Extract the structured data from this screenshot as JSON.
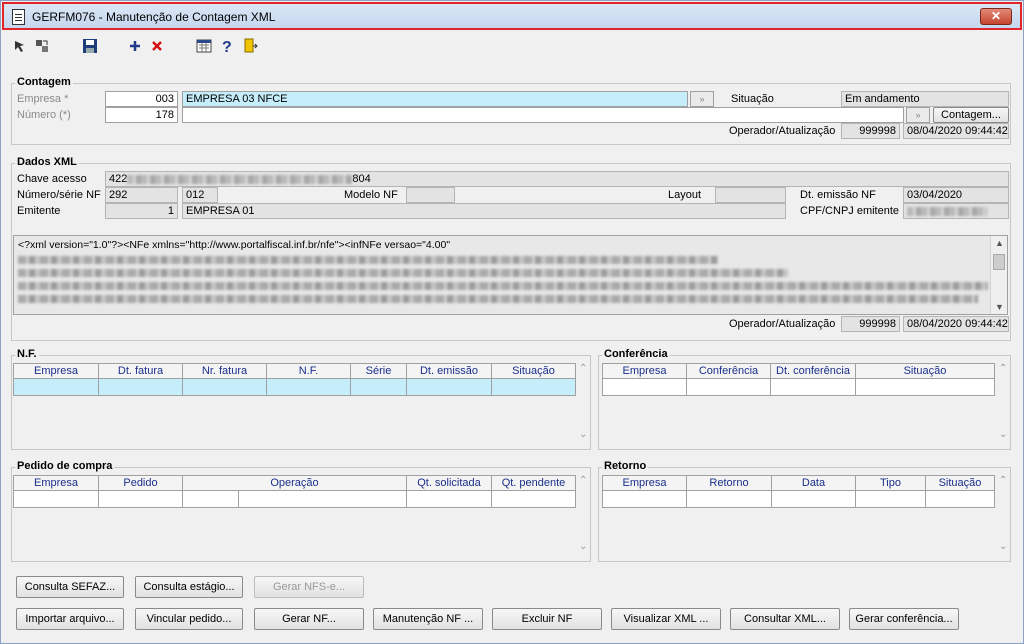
{
  "window": {
    "title": "GERFM076 - Manutenção de Contagem XML",
    "close_label": "✕"
  },
  "toolbar": {
    "icons": [
      "select-icon",
      "navigate-icon",
      "save-icon",
      "add-icon",
      "delete-icon",
      "calculator-icon",
      "help-icon",
      "exit-icon"
    ]
  },
  "contagem": {
    "title": "Contagem",
    "empresa_label": "Empresa *",
    "empresa_code": "003",
    "empresa_name": "EMPRESA 03 NFCE",
    "numero_label": "Número (*)",
    "numero_value": "178",
    "numero_desc": "",
    "situacao_label": "Situação",
    "situacao_value": "Em andamento",
    "contagem_button": "Contagem...",
    "operador_label": "Operador/Atualização",
    "operador_value": "999998",
    "operador_datetime": "08/04/2020 09:44:42"
  },
  "dados_xml": {
    "title": "Dados XML",
    "chave_label": "Chave acesso",
    "chave_prefix": "422",
    "chave_suffix": "804",
    "numero_serie_label": "Número/série NF",
    "numero_value": "292",
    "serie_value": "012",
    "modelo_label": "Modelo NF",
    "modelo_value": "",
    "layout_label": "Layout",
    "layout_value": "",
    "dt_emissao_label": "Dt. emissão NF",
    "dt_emissao_value": "03/04/2020",
    "emitente_label": "Emitente",
    "emitente_code": "1",
    "emitente_name": "EMPRESA 01",
    "cpf_cnpj_label": "CPF/CNPJ emitente",
    "xml_first_line": "<?xml version=\"1.0\"?><NFe xmlns=\"http://www.portalfiscal.inf.br/nfe\"><infNFe versao=\"4.00\"",
    "operador_label": "Operador/Atualização",
    "operador_value": "999998",
    "operador_datetime": "08/04/2020 09:44:42"
  },
  "nf": {
    "title": "N.F.",
    "columns": [
      "Empresa",
      "Dt. fatura",
      "Nr. fatura",
      "N.F.",
      "Série",
      "Dt. emissão",
      "Situação"
    ]
  },
  "conferencia": {
    "title": "Conferência",
    "columns": [
      "Empresa",
      "Conferência",
      "Dt. conferência",
      "Situação"
    ]
  },
  "pedido": {
    "title": "Pedido de compra",
    "columns": [
      "Empresa",
      "Pedido",
      "Operação",
      "Qt. solicitada",
      "Qt. pendente"
    ]
  },
  "retorno": {
    "title": "Retorno",
    "columns": [
      "Empresa",
      "Retorno",
      "Data",
      "Tipo",
      "Situação"
    ]
  },
  "buttons": {
    "consulta_sefaz": "Consulta SEFAZ...",
    "consulta_estagio": "Consulta estágio...",
    "gerar_nfse": "Gerar NFS-e...",
    "importar_arquivo": "Importar arquivo...",
    "vincular_pedido": "Vincular pedido...",
    "gerar_nf": "Gerar NF...",
    "manutencao_nf": "Manutenção NF ...",
    "excluir_nf": "Excluir NF",
    "visualizar_xml": "Visualizar XML ...",
    "consultar_xml": "Consultar XML...",
    "gerar_conferencia": "Gerar conferência..."
  }
}
